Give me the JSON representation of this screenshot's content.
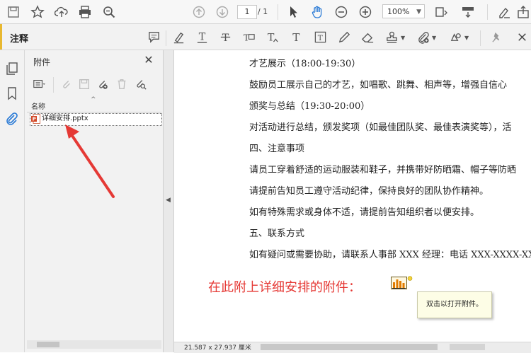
{
  "toolbar": {
    "icons": [
      "save-icon",
      "bookmark-star-icon",
      "upload-icon",
      "print-icon",
      "zoom-search-icon",
      "page-up-icon",
      "page-down-icon",
      "select-cursor-icon",
      "hand-tool-icon",
      "zoom-out-icon",
      "zoom-in-icon",
      "page-fit-icon",
      "scroll-mode-icon",
      "sign-icon",
      "share-icon"
    ],
    "page_current": "1",
    "page_total": "/ 1",
    "zoom": "100%"
  },
  "annotation_bar": {
    "title": "注释",
    "tools": [
      "sticky-note-icon",
      "highlight-icon",
      "underline-text-icon",
      "strikethrough-icon",
      "replace-text-icon",
      "insert-text-icon",
      "add-text-icon",
      "text-box-icon",
      "pencil-icon",
      "eraser-icon",
      "stamp-icon",
      "attach-file-icon",
      "shapes-icon",
      "pin-icon"
    ]
  },
  "rail": {
    "icons": [
      "pages-icon",
      "bookmarks-icon",
      "attachments-paperclip-icon"
    ]
  },
  "panel": {
    "title": "附件",
    "column_name": "名称",
    "files": [
      {
        "name": "详细安排.pptx",
        "icon": "pptx-file-icon"
      }
    ]
  },
  "document": {
    "lines": [
      "才艺展示（18:00-19:30）",
      "鼓励员工展示自己的才艺，如唱歌、跳舞、相声等，增强自信心",
      "颁奖与总结（19:30-20:00）",
      "对活动进行总结，颁发奖项（如最佳团队奖、最佳表演奖等），活",
      "四、注意事项",
      "请员工穿着舒适的运动服装和鞋子，并携带好防晒霜、帽子等防晒",
      "请提前告知员工遵守活动纪律，保持良好的团队协作精神。",
      "如有特殊需求或身体不适，请提前告知组织者以便安排。",
      "五、联系方式",
      "如有疑问或需要协助，请联系人事部 XXX 经理：电话 XXX-XXXX-XX"
    ],
    "red_text": "在此附上详细安排的附件：",
    "tooltip": "双击以打开附件。"
  },
  "status": {
    "page_size": "21.587 x 27.937 厘米"
  },
  "colors": {
    "accent": "#e8b830",
    "red_text": "#e53935",
    "arrow": "#e53935",
    "tooltip_bg": "#fdfde6"
  }
}
